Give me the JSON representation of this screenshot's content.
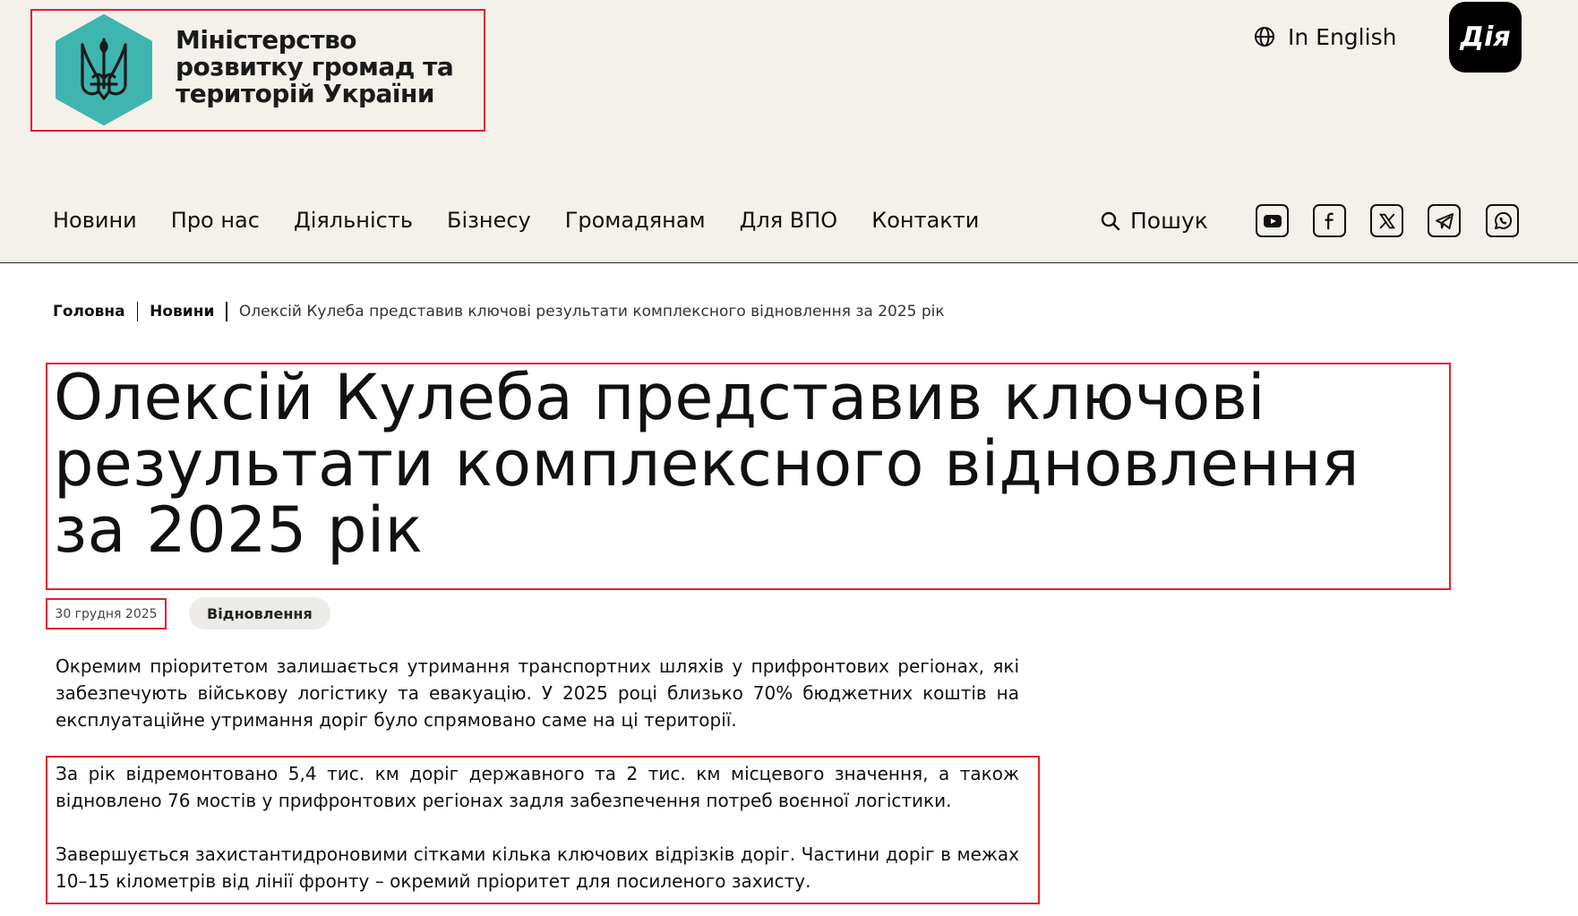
{
  "header": {
    "logo_text": "Міністерство розвитку громад та територій України",
    "lang_label": "In English",
    "diia_label": "Дія"
  },
  "nav": {
    "items": [
      {
        "label": "Новини"
      },
      {
        "label": "Про нас"
      },
      {
        "label": "Діяльність"
      },
      {
        "label": "Бізнесу"
      },
      {
        "label": "Громадянам"
      },
      {
        "label": "Для ВПО"
      },
      {
        "label": "Контакти"
      }
    ],
    "search_label": "Пошук",
    "social": [
      "youtube-icon",
      "facebook-icon",
      "x-icon",
      "telegram-icon",
      "whatsapp-icon"
    ]
  },
  "breadcrumb": {
    "home": "Головна",
    "news": "Новини",
    "current": "Олексій Кулеба представив ключові результати комплексного відновлення за 2025 рік"
  },
  "article": {
    "title": "Олексій Кулеба представив ключові результати комплексного відновлення за 2025 рік",
    "date": "30 грудня 2025",
    "tag": "Відновлення",
    "paragraphs": [
      "Окремим пріоритетом залишається утримання транспортних шляхів у прифронтових регіонах, які забезпечують військову логістику та евакуацію. У 2025 році близько 70% бюджетних коштів на експлуатаційне утримання доріг було спрямовано саме на ці території.",
      "За рік відремонтовано 5,4 тис. км доріг державного та 2 тис. км місцевого значення, а також відновлено 76 мостів у прифронтових регіонах задля забезпечення потреб воєнної логістики.",
      "Завершується захистантидроновими сітками кілька ключових відрізків доріг. Частини доріг в межах 10–15 кілометрів від лінії фронту – окремий пріоритет для посиленого захисту."
    ]
  },
  "colors": {
    "header_bg": "#f4f1ea",
    "logo_teal": "#3fb5b0",
    "highlight": "#e0202e"
  }
}
